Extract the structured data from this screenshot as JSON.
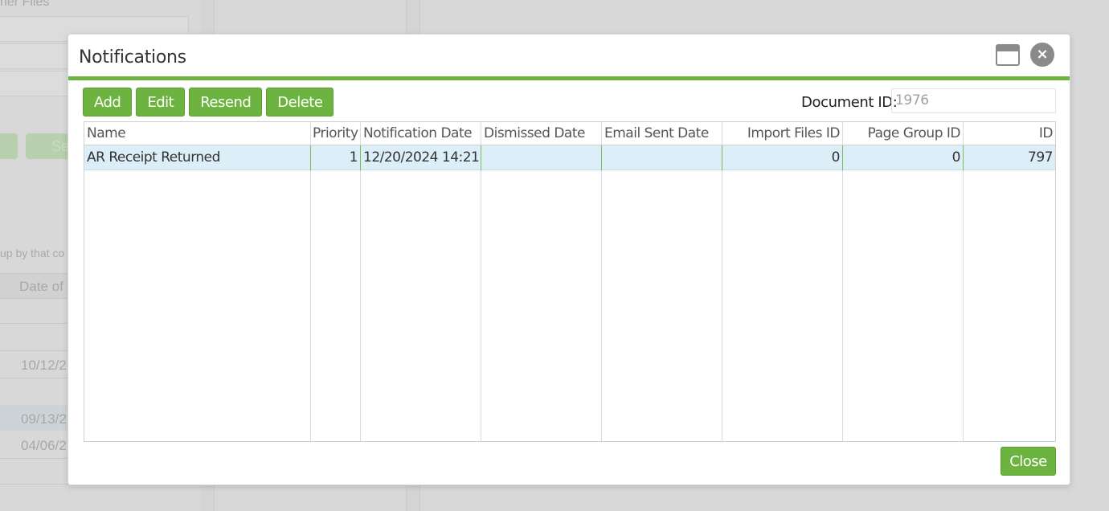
{
  "background": {
    "top_label": "ner Files",
    "button_label": "Se",
    "group_hint": "up by that co",
    "column_header": "Date of",
    "dates": [
      "10/12/2",
      "09/13/2",
      "04/06/2"
    ]
  },
  "dialog": {
    "title": "Notifications",
    "close_glyph": "×"
  },
  "toolbar": {
    "add_label": "Add",
    "edit_label": "Edit",
    "resend_label": "Resend",
    "delete_label": "Delete"
  },
  "document_id": {
    "label": "Document ID:",
    "placeholder": "1976"
  },
  "grid": {
    "columns": [
      "Name",
      "Priority",
      "Notification Date",
      "Dismissed Date",
      "Email Sent Date",
      "Import Files ID",
      "Page Group ID",
      "ID"
    ],
    "rows": [
      {
        "name": "AR Receipt Returned",
        "priority": "1",
        "notification_date": "12/20/2024 14:21",
        "dismissed_date": "",
        "email_sent_date": "",
        "import_files_id": "0",
        "page_group_id": "0",
        "id": "797"
      }
    ]
  },
  "footer": {
    "close_label": "Close"
  },
  "colors": {
    "accent": "#6db33f",
    "selected_row": "#dceef8"
  }
}
